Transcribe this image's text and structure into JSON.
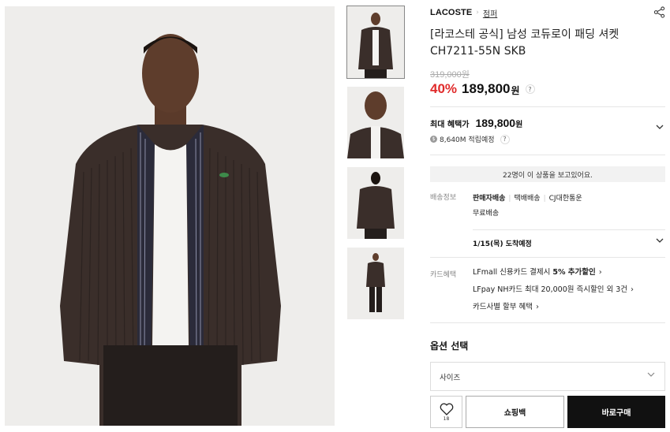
{
  "product": {
    "brand": "LACOSTE",
    "category": "점퍼",
    "title_line1": "[라코스테 공식] 남성 코듀로이 패딩 셔켓",
    "title_line2": "CH7211-55N SKB",
    "original_price": "319,000원",
    "discount": "40%",
    "price": "189,800",
    "price_unit": "원",
    "help_mark": "?"
  },
  "benefit": {
    "label": "최대 혜택가",
    "price": "189,800",
    "unit": "원",
    "points": "8,640M 적립예정",
    "coin_symbol": "$",
    "help_mark": "?"
  },
  "viewers_text": "22명이 이 상품을 보고있어요.",
  "shipping": {
    "label": "배송정보",
    "seller": "판매자배송",
    "method": "택배배송",
    "carrier": "CJ대한통운",
    "fee": "무료배송",
    "arrival": "1/15(목) 도착예정"
  },
  "card": {
    "label": "카드혜택",
    "line1_pre": "LFmall 신용카드 결제시 ",
    "line1_bold": "5% 추가할인",
    "line2": "LFpay NH카드 최대 20,000원 즉시할인 외 3건",
    "line3": "카드사별 할부 혜택"
  },
  "options": {
    "title": "옵션 선택",
    "size_placeholder": "사이즈"
  },
  "actions": {
    "wish_count": "18",
    "cart_label": "쇼핑백",
    "buy_label": "바로구매"
  },
  "icons": {
    "share": "share-icon",
    "heart": "heart-icon",
    "chevron": "chevron-down-icon"
  },
  "colors": {
    "discount": "#e02b2b",
    "buy_button": "#111111",
    "jacket": "#3a2e2a"
  }
}
